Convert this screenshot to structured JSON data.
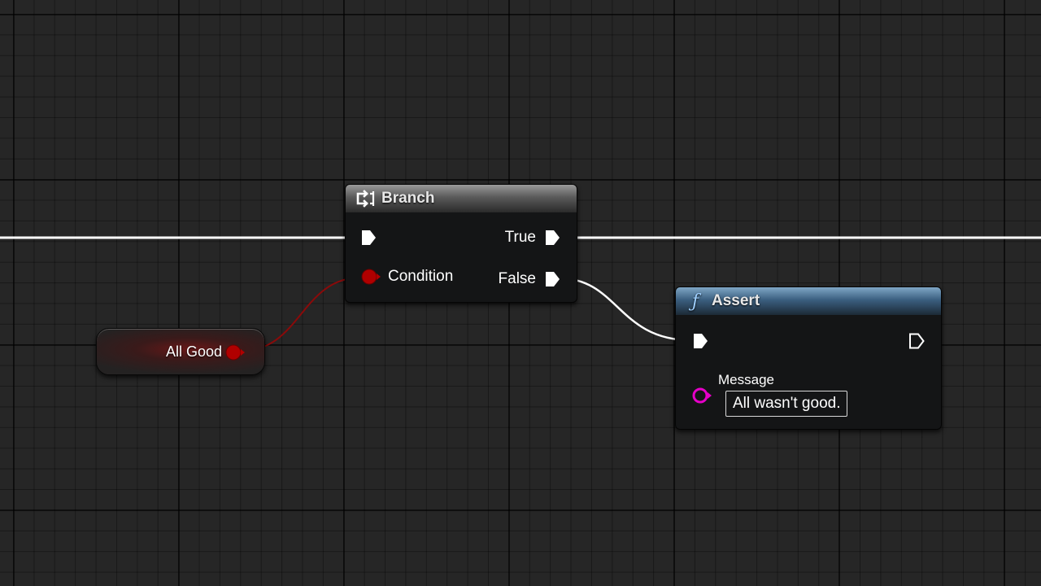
{
  "graph": {
    "variable_node": {
      "label": "All Good",
      "pin_color": "#a50000"
    },
    "branch_node": {
      "title": "Branch",
      "icon": "branch-icon",
      "header_color": "#8a8a8a",
      "pins": {
        "condition": "Condition",
        "true_label": "True",
        "false_label": "False"
      }
    },
    "assert_node": {
      "title": "Assert",
      "icon": "function-icon",
      "header_color": "#5a84a6",
      "message_label": "Message",
      "message_value": "All wasn't good.",
      "string_pin_color": "#e600c8"
    },
    "wires": {
      "exec_color": "#ffffff",
      "bool_color": "#8a0a0a"
    }
  }
}
